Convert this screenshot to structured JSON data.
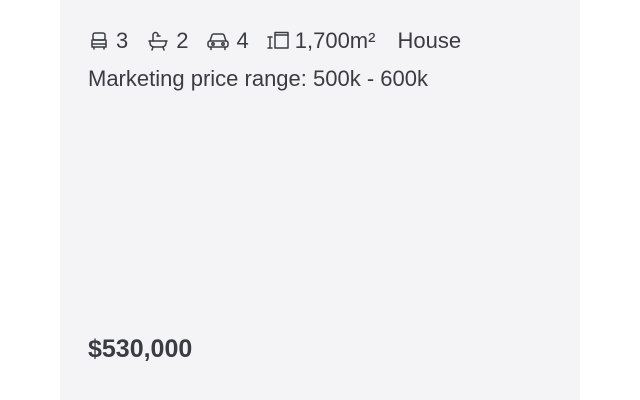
{
  "listing": {
    "features": {
      "bedrooms": {
        "icon": "bed-icon",
        "value": "3"
      },
      "bathrooms": {
        "icon": "bath-icon",
        "value": "2"
      },
      "parking": {
        "icon": "car-icon",
        "value": "4"
      },
      "land_size": {
        "icon": "land-size-icon",
        "value": "1,700m²"
      },
      "property_type": "House"
    },
    "price_range_text": "Marketing price range: 500k - 600k",
    "price": "$530,000"
  },
  "colors": {
    "card_background": "#f4f4f6",
    "text": "#3b3b43"
  }
}
